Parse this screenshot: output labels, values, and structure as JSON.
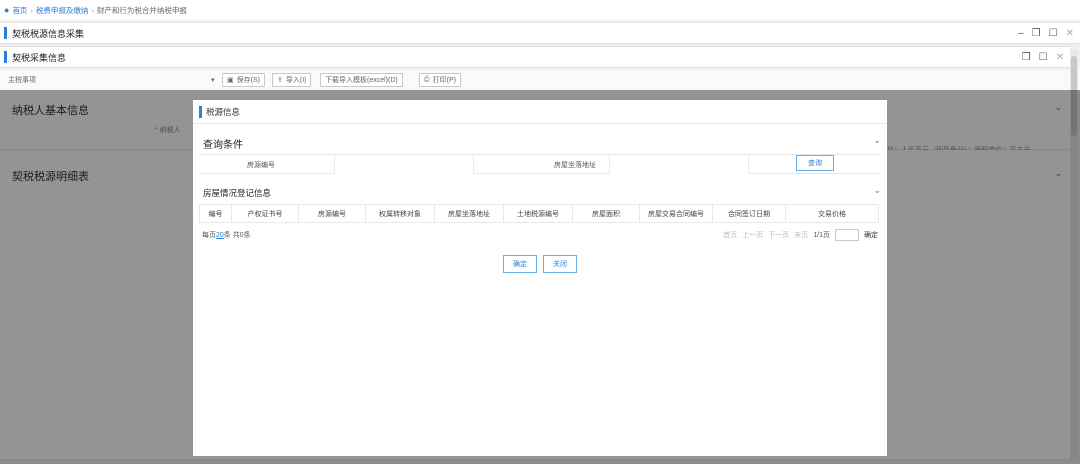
{
  "breadcrumb": {
    "home": "首页",
    "level2": "税费申报及缴纳",
    "current": "财产和行为税合并纳税申报"
  },
  "outer_window": {
    "title": "契税税源信息采集"
  },
  "inner_window": {
    "title": "契税采集信息"
  },
  "toolbar": {
    "left_label": "主税事项",
    "buttons": [
      "保存(S)",
      "导入(I)",
      "下载导入模板(excel)(D)",
      "打印(P)"
    ]
  },
  "background": {
    "panel1_title": "纳税人基本信息",
    "panel1_field": "* 纳税人",
    "panel1_note": "位：人民币元（列至角分）；面积单位：平方米",
    "panel2_title": "契税税源明细表"
  },
  "modal": {
    "title": "税源信息",
    "query": {
      "section_title": "查询条件",
      "house_no_label": "房源编号",
      "house_no_value": "",
      "address_label": "房屋坐落地址",
      "address_value": "",
      "search_button": "查询"
    },
    "registry": {
      "section_title": "房屋情况登记信息",
      "columns": [
        "编号",
        "产权证书号",
        "房源编号",
        "权属转移对象",
        "房屋坐落地址",
        "土地税源编号",
        "房屋面积",
        "房屋交易合同编号",
        "合同签订日期",
        "交易价格"
      ],
      "rows": []
    },
    "pager": {
      "per_page_prefix": "每页",
      "per_page": "20",
      "per_page_suffix": "条 共0条",
      "first": "首页",
      "prev": "上一页",
      "next": "下一页",
      "last": "末页",
      "page_info": "1/1页",
      "go": "确定"
    },
    "confirm_button": "确定",
    "close_button": "关闭"
  },
  "colors": {
    "accent": "#2b7fd6",
    "overlay": "rgba(0,0,0,0.42)"
  }
}
